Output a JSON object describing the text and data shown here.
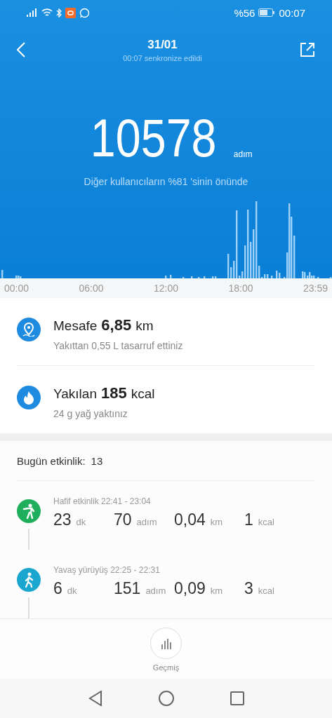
{
  "status_bar": {
    "battery_text": "%56",
    "time": "00:07"
  },
  "header": {
    "title": "31/01",
    "subtitle": "00:07 senkronize edildi"
  },
  "summary": {
    "steps": "10578",
    "unit": "adım",
    "note": "Diğer kullanıcıların %81 'sinin önünde"
  },
  "axis_labels": [
    "00:00",
    "06:00",
    "12:00",
    "18:00",
    "23:59"
  ],
  "stats": [
    {
      "kind": "distance",
      "label": "Mesafe",
      "value": "6,85",
      "unit": "km",
      "note": "Yakıttan 0,55 L tasarruf ettiniz"
    },
    {
      "kind": "calories",
      "label": "Yakılan",
      "value": "185",
      "unit": "kcal",
      "note": "24 g yağ yaktınız"
    }
  ],
  "activity": {
    "label": "Bugün etkinlik:",
    "count": "13",
    "items": [
      {
        "kind": "light",
        "color": "#1fae5b",
        "title": "Hafif etkinlik 22:41 - 23:04",
        "metrics": [
          {
            "value": "23",
            "unit": "dk"
          },
          {
            "value": "70",
            "unit": "adım"
          },
          {
            "value": "0,04",
            "unit": "km"
          },
          {
            "value": "1",
            "unit": "kcal"
          }
        ]
      },
      {
        "kind": "walk",
        "color": "#1ba6cf",
        "title": "Yavaş yürüyüş 22:25 - 22:31",
        "metrics": [
          {
            "value": "6",
            "unit": "dk"
          },
          {
            "value": "151",
            "unit": "adım"
          },
          {
            "value": "0,09",
            "unit": "km"
          },
          {
            "value": "3",
            "unit": "kcal"
          }
        ]
      }
    ]
  },
  "bottom": {
    "history_label": "Geçmiş"
  }
}
